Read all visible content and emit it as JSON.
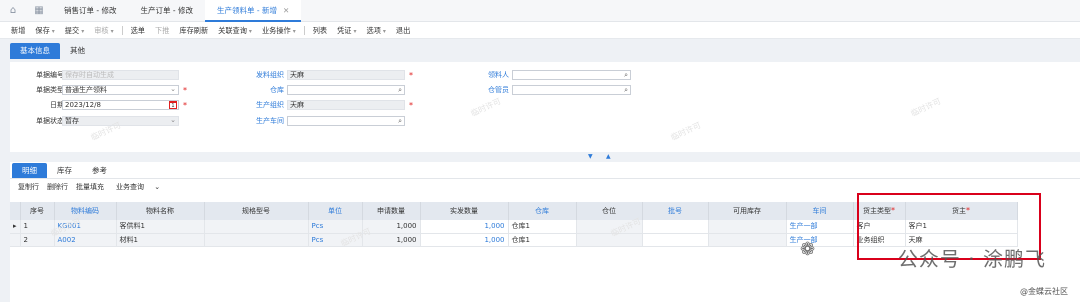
{
  "tabs": {
    "t1": "销售订单 - 修改",
    "t2": "生产订单 - 修改",
    "t3": "生产领料单 - 新增",
    "close": "✕"
  },
  "toolbar": {
    "new": "新增",
    "save": "保存",
    "submit": "提交",
    "audit": "审核",
    "select_bill": "选单",
    "push": "下推",
    "stock_refresh": "库存刷新",
    "related": "关联查询",
    "business": "业务操作",
    "list": "列表",
    "voucher": "凭证",
    "options": "选项",
    "exit": "退出"
  },
  "subtabs": {
    "basic": "基本信息",
    "other": "其他"
  },
  "form": {
    "bill_no_label": "单据编号",
    "bill_no_placeholder": "保存时自动生成",
    "bill_type_label": "单据类型",
    "bill_type_value": "普通生产领料",
    "date_label": "日期",
    "date_value": "2023/12/8",
    "cal": "1",
    "status_label": "单据状态",
    "status_value": "暂存",
    "issue_org_label": "发料组织",
    "issue_org_value": "天麻",
    "warehouse_label": "仓库",
    "prod_org_label": "生产组织",
    "prod_org_value": "天麻",
    "workshop_label": "生产车间",
    "picker_label": "领料人",
    "keeper_label": "仓管员",
    "req": "*"
  },
  "detail_tabs": {
    "detail": "明细",
    "stock": "库存",
    "ref": "参考"
  },
  "detail_tools": {
    "copy": "复制行",
    "delete": "删除行",
    "batch": "批量填充",
    "query": "业务查询"
  },
  "grid": {
    "headers": [
      "序号",
      "物料编码",
      "物料名称",
      "规格型号",
      "单位",
      "申请数量",
      "实发数量",
      "仓库",
      "仓位",
      "批号",
      "可用库存",
      "车间",
      "货主类型",
      "货主"
    ],
    "rows": [
      {
        "marker": "▸",
        "seq": "1",
        "code": "KG001",
        "name": "客供料1",
        "spec": "",
        "unit": "Pcs",
        "req_qty": "1,000",
        "act_qty": "1,000",
        "wh": "仓库1",
        "loc": "",
        "lot": "",
        "avail": "",
        "shop": "生产一部",
        "owner_type": "客户",
        "owner": "客户1"
      },
      {
        "marker": "",
        "seq": "2",
        "code": "A002",
        "name": "材料1",
        "spec": "",
        "unit": "Pcs",
        "req_qty": "1,000",
        "act_qty": "1,000",
        "wh": "仓库1",
        "loc": "",
        "lot": "",
        "avail": "",
        "shop": "生产一部",
        "owner_type": "业务组织",
        "owner": "天麻"
      }
    ]
  },
  "watermark": {
    "text": "公众号 · 涂鹏飞",
    "site": "@金蝶云社区"
  },
  "ghost": "临时许可",
  "colors": {
    "accent": "#2e7bd9",
    "required": "#e02020",
    "highlight_box": "#d9001b"
  }
}
